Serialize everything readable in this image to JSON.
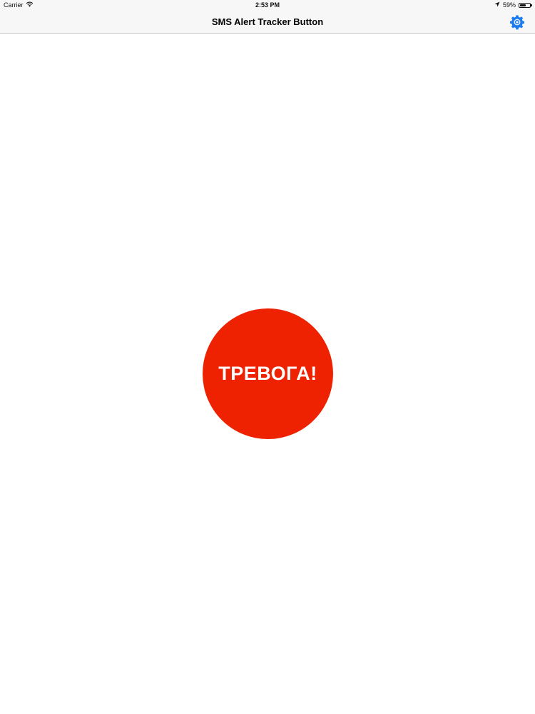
{
  "status_bar": {
    "carrier": "Carrier",
    "time": "2:53 PM",
    "battery_percent": "59%",
    "battery_level": 0.59,
    "icons": [
      "wifi-icon",
      "location-arrow-icon",
      "battery-icon"
    ]
  },
  "nav": {
    "title": "SMS Alert Tracker Button",
    "settings_icon": "gear-icon"
  },
  "alarm_button": {
    "label": "ТРЕВОГА!",
    "color": "#ee2200"
  },
  "colors": {
    "accent": "#1a7cf0",
    "alarm": "#ee2200"
  }
}
